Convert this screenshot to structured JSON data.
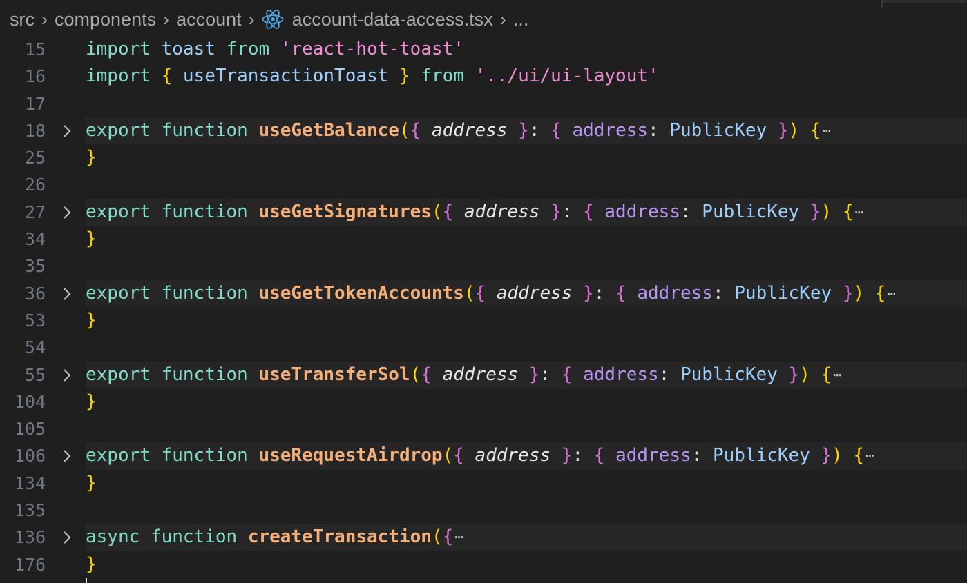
{
  "breadcrumb": {
    "items": [
      "src",
      "components",
      "account"
    ],
    "file": "account-data-access.tsx",
    "file_icon": "react-icon",
    "more": "..."
  },
  "lines": [
    {
      "num": "15",
      "folded": false,
      "tokens": [
        [
          "kw",
          "import"
        ],
        [
          "punct",
          " "
        ],
        [
          "id",
          "toast"
        ],
        [
          "punct",
          " "
        ],
        [
          "kw",
          "from"
        ],
        [
          "punct",
          " "
        ],
        [
          "str",
          "'react-hot-toast'"
        ]
      ]
    },
    {
      "num": "16",
      "folded": false,
      "tokens": [
        [
          "kw",
          "import"
        ],
        [
          "punct",
          " "
        ],
        [
          "brace1",
          "{"
        ],
        [
          "punct",
          " "
        ],
        [
          "id",
          "useTransactionToast"
        ],
        [
          "punct",
          " "
        ],
        [
          "brace1",
          "}"
        ],
        [
          "punct",
          " "
        ],
        [
          "kw",
          "from"
        ],
        [
          "punct",
          " "
        ],
        [
          "str",
          "'../ui/ui-layout'"
        ]
      ]
    },
    {
      "num": "17",
      "folded": false,
      "tokens": []
    },
    {
      "num": "18",
      "folded": true,
      "tokens": [
        [
          "kw",
          "export"
        ],
        [
          "punct",
          " "
        ],
        [
          "kw",
          "function"
        ],
        [
          "punct",
          " "
        ],
        [
          "fn",
          "useGetBalance"
        ],
        [
          "brace1",
          "("
        ],
        [
          "brace2",
          "{"
        ],
        [
          "punct",
          " "
        ],
        [
          "param",
          "address"
        ],
        [
          "punct",
          " "
        ],
        [
          "brace2",
          "}"
        ],
        [
          "punct",
          ": "
        ],
        [
          "brace2",
          "{"
        ],
        [
          "punct",
          " "
        ],
        [
          "prop",
          "address"
        ],
        [
          "punct",
          ": "
        ],
        [
          "type",
          "PublicKey"
        ],
        [
          "punct",
          " "
        ],
        [
          "brace2",
          "}"
        ],
        [
          "brace1",
          ")"
        ],
        [
          "punct",
          " "
        ],
        [
          "brace1",
          "{"
        ]
      ]
    },
    {
      "num": "25",
      "folded": false,
      "tokens": [
        [
          "brace1",
          "}"
        ]
      ]
    },
    {
      "num": "26",
      "folded": false,
      "tokens": []
    },
    {
      "num": "27",
      "folded": true,
      "tokens": [
        [
          "kw",
          "export"
        ],
        [
          "punct",
          " "
        ],
        [
          "kw",
          "function"
        ],
        [
          "punct",
          " "
        ],
        [
          "fn",
          "useGetSignatures"
        ],
        [
          "brace1",
          "("
        ],
        [
          "brace2",
          "{"
        ],
        [
          "punct",
          " "
        ],
        [
          "param",
          "address"
        ],
        [
          "punct",
          " "
        ],
        [
          "brace2",
          "}"
        ],
        [
          "punct",
          ": "
        ],
        [
          "brace2",
          "{"
        ],
        [
          "punct",
          " "
        ],
        [
          "prop",
          "address"
        ],
        [
          "punct",
          ": "
        ],
        [
          "type",
          "PublicKey"
        ],
        [
          "punct",
          " "
        ],
        [
          "brace2",
          "}"
        ],
        [
          "brace1",
          ")"
        ],
        [
          "punct",
          " "
        ],
        [
          "brace1",
          "{"
        ]
      ]
    },
    {
      "num": "34",
      "folded": false,
      "tokens": [
        [
          "brace1",
          "}"
        ]
      ]
    },
    {
      "num": "35",
      "folded": false,
      "tokens": []
    },
    {
      "num": "36",
      "folded": true,
      "tokens": [
        [
          "kw",
          "export"
        ],
        [
          "punct",
          " "
        ],
        [
          "kw",
          "function"
        ],
        [
          "punct",
          " "
        ],
        [
          "fn",
          "useGetTokenAccounts"
        ],
        [
          "brace1",
          "("
        ],
        [
          "brace2",
          "{"
        ],
        [
          "punct",
          " "
        ],
        [
          "param",
          "address"
        ],
        [
          "punct",
          " "
        ],
        [
          "brace2",
          "}"
        ],
        [
          "punct",
          ": "
        ],
        [
          "brace2",
          "{"
        ],
        [
          "punct",
          " "
        ],
        [
          "prop",
          "address"
        ],
        [
          "punct",
          ": "
        ],
        [
          "type",
          "PublicKey"
        ],
        [
          "punct",
          " "
        ],
        [
          "brace2",
          "}"
        ],
        [
          "brace1",
          ")"
        ],
        [
          "punct",
          " "
        ],
        [
          "brace1",
          "{"
        ]
      ]
    },
    {
      "num": "53",
      "folded": false,
      "tokens": [
        [
          "brace1",
          "}"
        ]
      ]
    },
    {
      "num": "54",
      "folded": false,
      "tokens": []
    },
    {
      "num": "55",
      "folded": true,
      "tokens": [
        [
          "kw",
          "export"
        ],
        [
          "punct",
          " "
        ],
        [
          "kw",
          "function"
        ],
        [
          "punct",
          " "
        ],
        [
          "fn",
          "useTransferSol"
        ],
        [
          "brace1",
          "("
        ],
        [
          "brace2",
          "{"
        ],
        [
          "punct",
          " "
        ],
        [
          "param",
          "address"
        ],
        [
          "punct",
          " "
        ],
        [
          "brace2",
          "}"
        ],
        [
          "punct",
          ": "
        ],
        [
          "brace2",
          "{"
        ],
        [
          "punct",
          " "
        ],
        [
          "prop",
          "address"
        ],
        [
          "punct",
          ": "
        ],
        [
          "type",
          "PublicKey"
        ],
        [
          "punct",
          " "
        ],
        [
          "brace2",
          "}"
        ],
        [
          "brace1",
          ")"
        ],
        [
          "punct",
          " "
        ],
        [
          "brace1",
          "{"
        ]
      ]
    },
    {
      "num": "104",
      "folded": false,
      "tokens": [
        [
          "brace1",
          "}"
        ]
      ]
    },
    {
      "num": "105",
      "folded": false,
      "tokens": []
    },
    {
      "num": "106",
      "folded": true,
      "tokens": [
        [
          "kw",
          "export"
        ],
        [
          "punct",
          " "
        ],
        [
          "kw",
          "function"
        ],
        [
          "punct",
          " "
        ],
        [
          "fn",
          "useRequestAirdrop"
        ],
        [
          "brace1",
          "("
        ],
        [
          "brace2",
          "{"
        ],
        [
          "punct",
          " "
        ],
        [
          "param",
          "address"
        ],
        [
          "punct",
          " "
        ],
        [
          "brace2",
          "}"
        ],
        [
          "punct",
          ": "
        ],
        [
          "brace2",
          "{"
        ],
        [
          "punct",
          " "
        ],
        [
          "prop",
          "address"
        ],
        [
          "punct",
          ": "
        ],
        [
          "type",
          "PublicKey"
        ],
        [
          "punct",
          " "
        ],
        [
          "brace2",
          "}"
        ],
        [
          "brace1",
          ")"
        ],
        [
          "punct",
          " "
        ],
        [
          "brace1",
          "{"
        ]
      ]
    },
    {
      "num": "134",
      "folded": false,
      "tokens": [
        [
          "brace1",
          "}"
        ]
      ]
    },
    {
      "num": "135",
      "folded": false,
      "tokens": []
    },
    {
      "num": "136",
      "folded": true,
      "tokens": [
        [
          "kw",
          "async"
        ],
        [
          "punct",
          " "
        ],
        [
          "kw",
          "function"
        ],
        [
          "punct",
          " "
        ],
        [
          "fn",
          "createTransaction"
        ],
        [
          "brace1",
          "("
        ],
        [
          "brace2",
          "{"
        ]
      ]
    },
    {
      "num": "176",
      "folded": false,
      "tokens": [
        [
          "brace1",
          "}"
        ]
      ]
    }
  ],
  "fold_marker": "⋯",
  "colors": {
    "background": "#1f1f1f",
    "keyword": "#7fdcc8",
    "function": "#f5b07a",
    "string": "#f08bd6",
    "bracket_level1": "#ffd700",
    "bracket_level2": "#d970d6",
    "property": "#b996f5",
    "type": "#9ccffc",
    "line_number": "#6e7681"
  }
}
